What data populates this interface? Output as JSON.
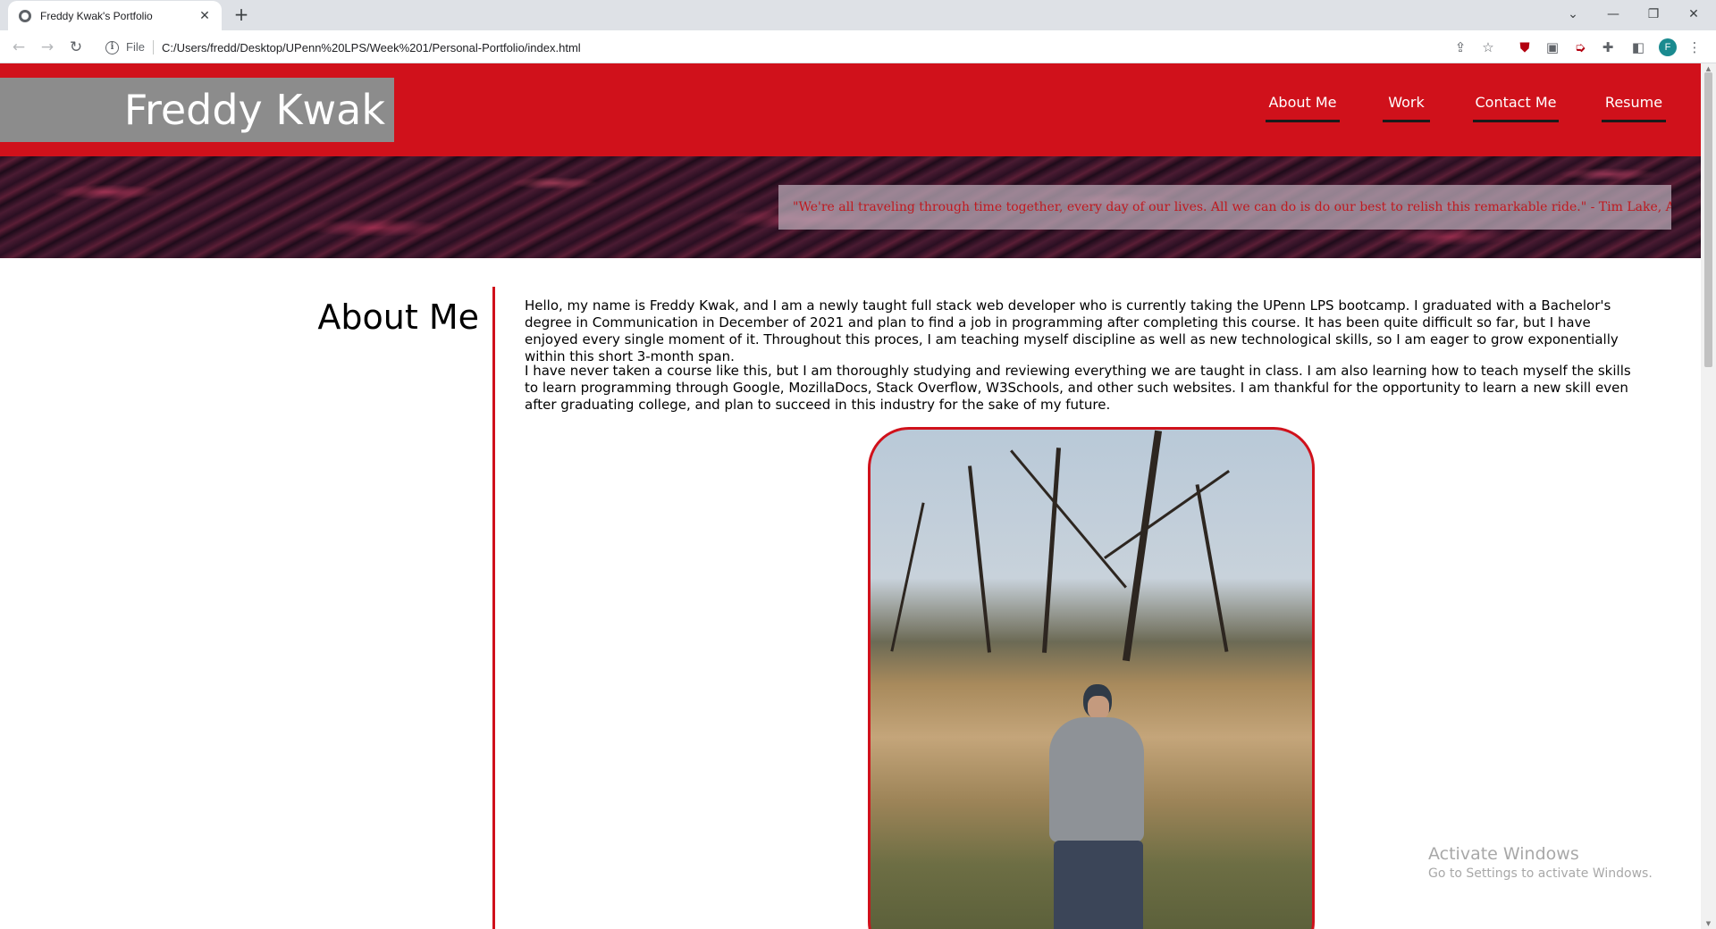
{
  "browser": {
    "tab_title": "Freddy Kwak's Portfolio",
    "tab_close": "✕",
    "new_tab": "+",
    "file_label": "File",
    "url": "C:/Users/fredd/Desktop/UPenn%20LPS/Week%201/Personal-Portfolio/index.html",
    "profile_initial": "F"
  },
  "site": {
    "title": "Freddy Kwak",
    "nav": [
      "About Me",
      "Work",
      "Contact Me",
      "Resume"
    ],
    "quote": "\"We're all traveling through time together, every day of our lives. All we can do is do our best to relish this remarkable ride.\" - Tim Lake, About Time -"
  },
  "about": {
    "heading": "About Me",
    "paragraphs": [
      "Hello, my name is Freddy Kwak, and I am a newly taught full stack web developer who is currently taking the UPenn LPS bootcamp. I graduated with a Bachelor's degree in Communication in December of 2021 and plan to find a job in programming after completing this course. It has been quite difficult so far, but I have enjoyed every single moment of it. Throughout this proces, I am teaching myself discipline as well as new technological skills, so I am eager to grow exponentially within this short 3-month span.",
      "I have never taken a course like this, but I am thoroughly studying and reviewing everything we are taught in class. I am also learning how to teach myself the skills to learn programming through Google, MozillaDocs, Stack Overflow, W3Schools, and other such websites. I am thankful for the opportunity to learn a new skill even after graduating college, and plan to succeed in this industry for the sake of my future."
    ]
  },
  "watermark": {
    "title": "Activate Windows",
    "subtitle": "Go to Settings to activate Windows."
  },
  "colors": {
    "brand_red": "#d0111b",
    "title_gray": "#8c8c8c"
  }
}
